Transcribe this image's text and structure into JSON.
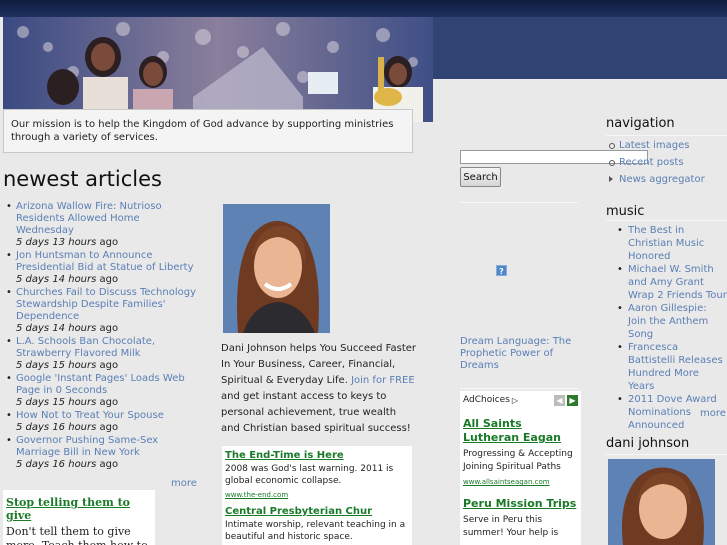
{
  "mission": "Our mission is to help the Kingdom of God advance by supporting ministries through a variety of services.",
  "newest": {
    "title": "newest articles",
    "items": [
      {
        "title": "Arizona Wallow Fire: Nutrioso Residents Allowed Home Wednesday",
        "age": "5 days 13 hours",
        "ago": "ago"
      },
      {
        "title": "Jon Huntsman to Announce Presidential Bid at Statue of Liberty",
        "age": "5 days 14 hours",
        "ago": "ago"
      },
      {
        "title": "Churches Fail to Discuss Technology Stewardship Despite Families' Dependence",
        "age": "5 days 14 hours",
        "ago": "ago"
      },
      {
        "title": "L.A. Schools Ban Chocolate, Strawberry Flavored Milk",
        "age": "5 days 15 hours",
        "ago": "ago"
      },
      {
        "title": "Google 'Instant Pages' Loads Web Page in 0 Seconds",
        "age": "5 days 15 hours",
        "ago": "ago"
      },
      {
        "title": "How Not to Treat Your Spouse",
        "age": "5 days 16 hours",
        "ago": "ago"
      },
      {
        "title": "Governor Pushing Same-Sex Marriage Bill in New York",
        "age": "5 days 16 hours",
        "ago": "ago"
      }
    ],
    "more": "more"
  },
  "ad_left": {
    "title": "Stop telling them to give",
    "text": "Don't tell them to give more, Teach them how to give."
  },
  "dani_block": {
    "text_before": "Dani Johnson helps You Succeed Faster In Your Business, Career, Financial, Spiritual & Everyday Life.",
    "link": "Join for FREE",
    "text_after": "and get instant access to keys to personal achievement, true wealth and Christian based spiritual success!"
  },
  "ad_mid": [
    {
      "title": "The End-Time is Here",
      "text": "2008 was God's last warning. 2011 is global economic collapse.",
      "url": "www.the-end.com"
    },
    {
      "title": "Central Presbyterian Chur",
      "text": "Intimate worship, relevant teaching in a beautiful and historic space.",
      "url": ""
    }
  ],
  "search": {
    "placeholder": "",
    "button": "Search"
  },
  "help_icon": "?",
  "dream_link": "Dream Language: The Prophetic Power of Dreams",
  "ad_right": {
    "adchoices": "AdChoices",
    "arrows": [
      "◀",
      "▶"
    ],
    "ads": [
      {
        "title": "All Saints Lutheran Eagan",
        "text": "Progressing & Accepting Joining Spiritual Paths",
        "url": "www.allsaintseagan.com"
      },
      {
        "title": "Peru Mission Trips",
        "text": "Serve in Peru this summer! Your help is",
        "url": ""
      }
    ]
  },
  "navigation": {
    "title": "navigation",
    "items": [
      "Latest images",
      "Recent posts",
      "News aggregator"
    ]
  },
  "music": {
    "title": "music",
    "items": [
      "The Best in Christian Music Honored",
      "Michael W. Smith and Amy Grant Wrap 2 Friends Tour",
      "Aaron Gillespie: Join the Anthem Song",
      "Francesca Battistelli Releases Hundred More Years",
      "2011 Dove Award Nominations Announced"
    ],
    "more": "more"
  },
  "dani_side": {
    "title": "dani johnson"
  },
  "colors": {
    "link": "#5a7fb5",
    "ad_title": "#1a7a28",
    "header_dark": "#0f1c3f",
    "header_panel": "#2f4473"
  }
}
